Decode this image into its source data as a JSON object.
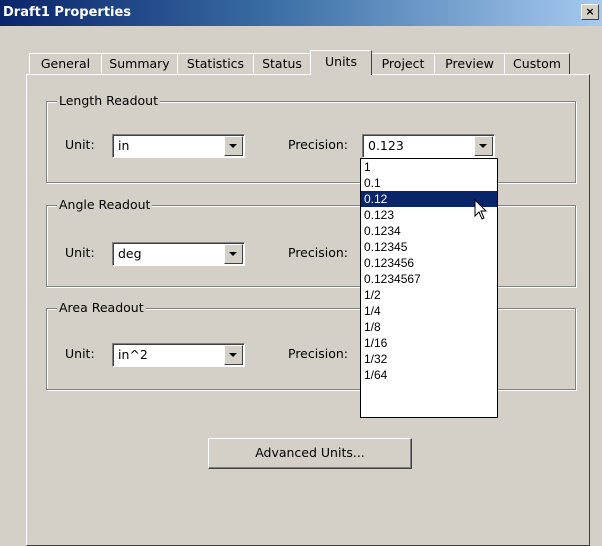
{
  "window": {
    "title": "Draft1 Properties",
    "close_glyph": "×"
  },
  "tabs": [
    {
      "label": "General"
    },
    {
      "label": "Summary"
    },
    {
      "label": "Statistics"
    },
    {
      "label": "Status"
    },
    {
      "label": "Units",
      "active": true
    },
    {
      "label": "Project"
    },
    {
      "label": "Preview"
    },
    {
      "label": "Custom"
    }
  ],
  "groups": {
    "length": {
      "legend": "Length Readout",
      "unit_label": "Unit:",
      "unit_value": "in",
      "precision_label": "Precision:",
      "precision_value": "0.123"
    },
    "angle": {
      "legend": "Angle Readout",
      "unit_label": "Unit:",
      "unit_value": "deg",
      "precision_label": "Precision:"
    },
    "area": {
      "legend": "Area Readout",
      "unit_label": "Unit:",
      "unit_value": "in^2",
      "precision_label": "Precision:"
    }
  },
  "precision_dropdown": {
    "options": [
      "1",
      "0.1",
      "0.12",
      "0.123",
      "0.1234",
      "0.12345",
      "0.123456",
      "0.1234567",
      "1/2",
      "1/4",
      "1/8",
      "1/16",
      "1/32",
      "1/64"
    ],
    "highlighted_index": 2
  },
  "buttons": {
    "advanced_units": "Advanced Units..."
  },
  "icons": {
    "close": "close-icon",
    "cursor": "mouse-pointer-icon",
    "dropdown": "chevron-down-icon"
  },
  "colors": {
    "titlebar_start": "#0a246a",
    "titlebar_end": "#a6caf0",
    "selection": "#0a246a",
    "face": "#d4d0c8"
  }
}
